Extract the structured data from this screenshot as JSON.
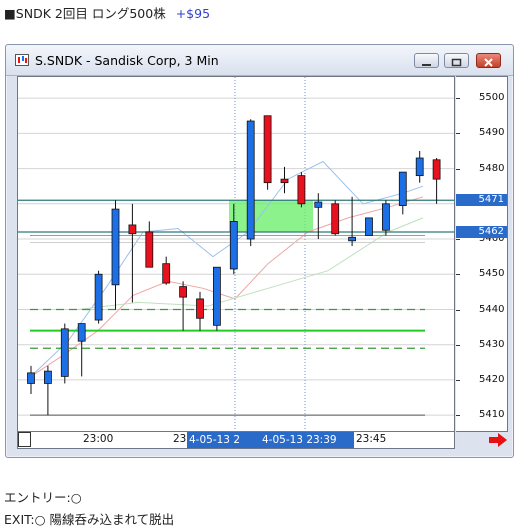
{
  "header": {
    "symbol": "■SNDK",
    "trade_label": "2回目 ロング500株",
    "gain": "+$95"
  },
  "window": {
    "title": "S.SNDK - Sandisk Corp, 3 Min",
    "icon": "chart-window-icon"
  },
  "chart_data": {
    "type": "candlestick",
    "y_ticks": [
      5410,
      5420,
      5430,
      5440,
      5450,
      5460,
      5470,
      5480,
      5490,
      5500
    ],
    "ylim": [
      5405.5,
      5506.0
    ],
    "price_tags": [
      "5471",
      "5462"
    ],
    "x_labels": [
      "23:00",
      "23",
      "23:45"
    ],
    "x_selected_labels": [
      "4-05-13  2",
      "4-05-13  23:39"
    ],
    "candles": [
      {
        "o": 5419.0,
        "h": 5424.0,
        "l": 5416.0,
        "c": 5422.0
      },
      {
        "o": 5419.0,
        "h": 5424.0,
        "l": 5410.0,
        "c": 5422.5
      },
      {
        "o": 5421.0,
        "h": 5436.0,
        "l": 5419.0,
        "c": 5434.5
      },
      {
        "o": 5431.0,
        "h": 5436.0,
        "l": 5421.0,
        "c": 5436.0
      },
      {
        "o": 5437.0,
        "h": 5451.0,
        "l": 5436.0,
        "c": 5450.0
      },
      {
        "o": 5447.0,
        "h": 5471.0,
        "l": 5440.0,
        "c": 5468.5
      },
      {
        "o": 5464.0,
        "h": 5470.0,
        "l": 5442.0,
        "c": 5461.5
      },
      {
        "o": 5462.0,
        "h": 5465.0,
        "l": 5452.0,
        "c": 5452.0
      },
      {
        "o": 5453.0,
        "h": 5455.0,
        "l": 5447.0,
        "c": 5447.5
      },
      {
        "o": 5446.5,
        "h": 5448.0,
        "l": 5434.0,
        "c": 5443.5
      },
      {
        "o": 5443.0,
        "h": 5445.0,
        "l": 5434.0,
        "c": 5437.5
      },
      {
        "o": 5435.5,
        "h": 5452.0,
        "l": 5434.0,
        "c": 5452.0
      },
      {
        "o": 5451.5,
        "h": 5470.0,
        "l": 5450.0,
        "c": 5465.0
      },
      {
        "o": 5460.0,
        "h": 5494.0,
        "l": 5458.0,
        "c": 5493.5
      },
      {
        "o": 5495.0,
        "h": 5495.0,
        "l": 5474.0,
        "c": 5476.0
      },
      {
        "o": 5477.0,
        "h": 5480.5,
        "l": 5473.0,
        "c": 5476.0
      },
      {
        "o": 5478.0,
        "h": 5479.0,
        "l": 5469.0,
        "c": 5470.0
      },
      {
        "o": 5469.0,
        "h": 5473.0,
        "l": 5460.0,
        "c": 5470.5
      },
      {
        "o": 5470.0,
        "h": 5471.0,
        "l": 5461.0,
        "c": 5461.5
      },
      {
        "o": 5459.5,
        "h": 5472.0,
        "l": 5458.0,
        "c": 5460.5
      },
      {
        "o": 5461.0,
        "h": 5466.0,
        "l": 5461.0,
        "c": 5466.0
      },
      {
        "o": 5462.5,
        "h": 5471.0,
        "l": 5461.0,
        "c": 5470.0
      },
      {
        "o": 5469.5,
        "h": 5479.0,
        "l": 5467.0,
        "c": 5479.0
      },
      {
        "o": 5478.0,
        "h": 5485.0,
        "l": 5476.0,
        "c": 5483.0
      },
      {
        "o": 5482.5,
        "h": 5483.0,
        "l": 5470.0,
        "c": 5477.0
      }
    ],
    "levels": {
      "upper_line": 5471,
      "lower_line": 5462,
      "solid_green": 5434,
      "dashed_upper": 5440,
      "dashed_lower": 5429
    },
    "colors": {
      "up": "#1d6fe6",
      "down": "#e8121f",
      "box": "#66ee66",
      "level": "#2b7a7a",
      "dashed": "#3a9a3a",
      "solid": "#22cc22"
    }
  },
  "notes": {
    "entry": "エントリー:○",
    "exit": "EXIT:○  陽線呑み込まれて脱出"
  },
  "arrow_icon": "red-right-arrow-icon"
}
